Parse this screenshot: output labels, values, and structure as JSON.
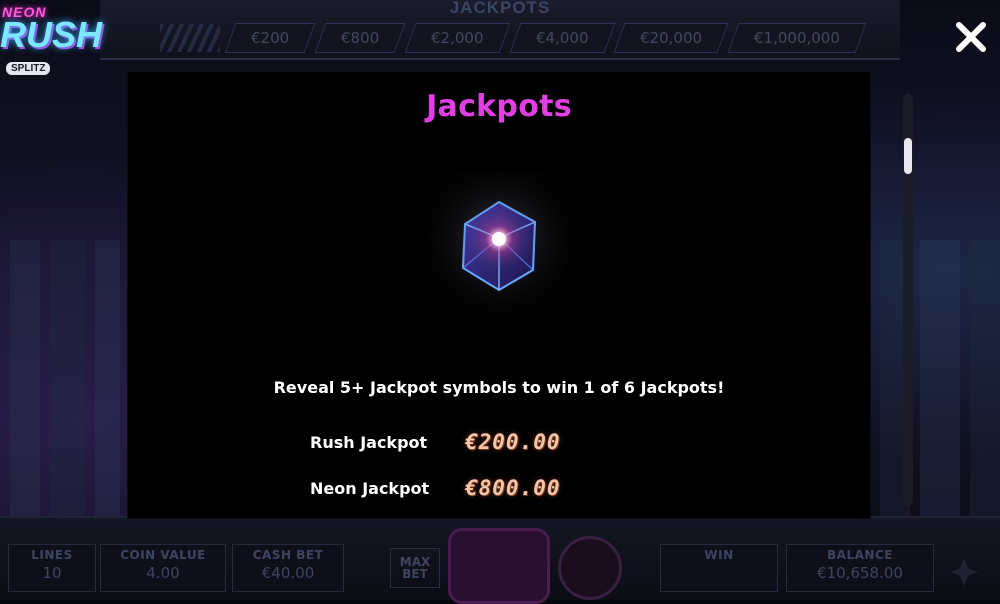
{
  "game": {
    "logo_top": "NEON",
    "logo_main": "RUSH",
    "logo_badge": "SPLITZ"
  },
  "topbar": {
    "title": "JACKPOTS",
    "jackpot_values": [
      "€200",
      "€800",
      "€2,000",
      "€4,000",
      "€20,000",
      "€1,000,000"
    ]
  },
  "dialog": {
    "title": "Jackpots",
    "description": "Reveal 5+ Jackpot symbols to win 1 of 6 Jackpots!",
    "jackpots": [
      {
        "name": "Rush Jackpot",
        "amount": "€200.00"
      },
      {
        "name": "Neon Jackpot",
        "amount": "€800.00"
      }
    ],
    "close_icon": "close-icon",
    "title_color": "#e23ee6"
  },
  "bottombar": {
    "lines_label": "LINES",
    "lines_value": "10",
    "coin_value_label": "COIN VALUE",
    "coin_value": "4.00",
    "cash_bet_label": "CASH BET",
    "cash_bet_value": "€40.00",
    "max_bet_label": "MAX BET",
    "win_label": "WIN",
    "win_value": "",
    "balance_label": "BALANCE",
    "balance_value": "€10,658.00"
  }
}
